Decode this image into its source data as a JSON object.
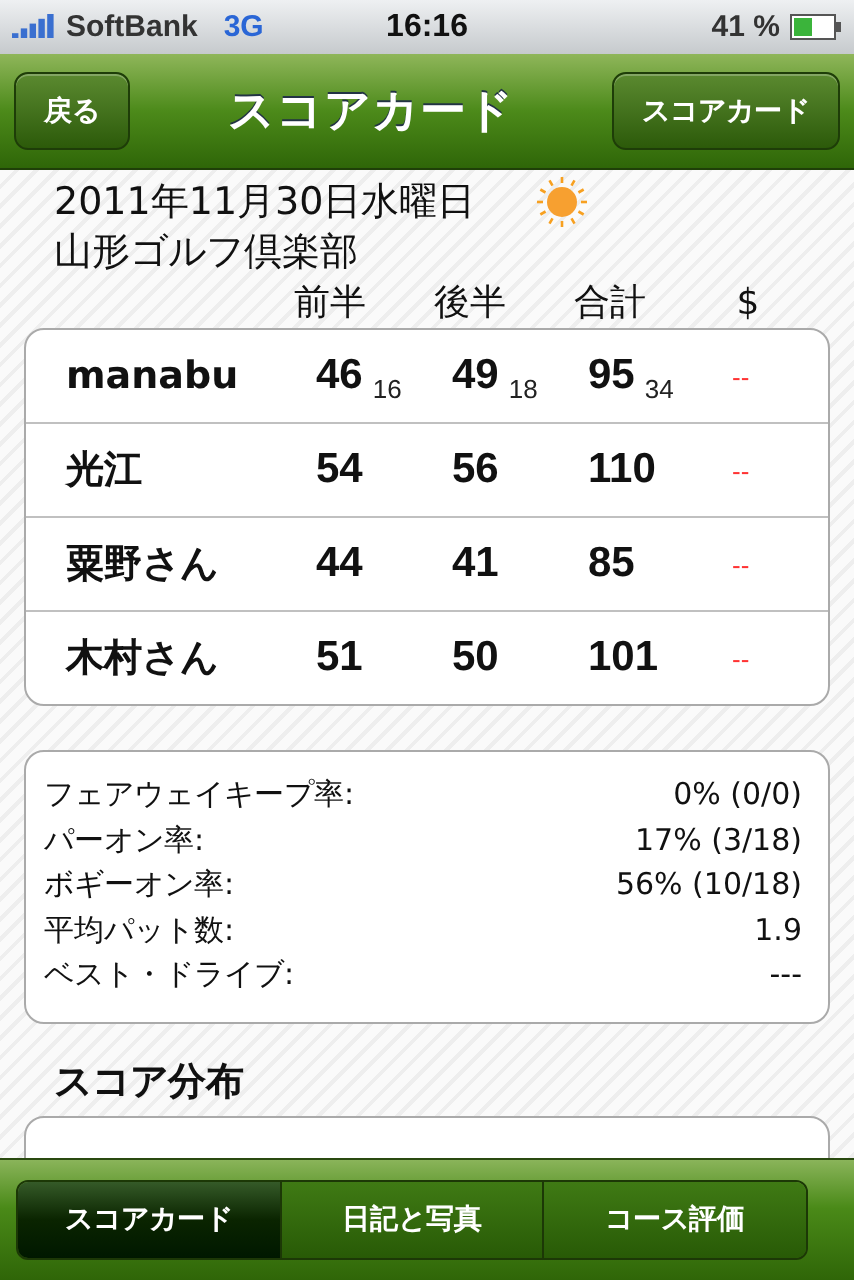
{
  "status_bar": {
    "carrier": "SoftBank",
    "network": "3G",
    "time": "16:16",
    "battery": "41 %"
  },
  "nav_bar": {
    "back_button": "戻る",
    "title": "スコアカード",
    "right_button": "スコアカード"
  },
  "round": {
    "date": "2011年11月30日水曜日",
    "course": "山形ゴルフ倶楽部"
  },
  "score_table": {
    "columns": [
      "前半",
      "後半",
      "合計",
      "$"
    ],
    "rows": [
      {
        "name": "manabu",
        "front": "46",
        "front_putts": "16",
        "back": "49",
        "back_putts": "18",
        "total": "95",
        "total_putts": "34",
        "money": "--"
      },
      {
        "name": "光江",
        "front": "54",
        "back": "56",
        "total": "110",
        "money": "--"
      },
      {
        "name": "粟野さん",
        "front": "44",
        "back": "41",
        "total": "85",
        "money": "--"
      },
      {
        "name": "木村さん",
        "front": "51",
        "back": "50",
        "total": "101",
        "money": "--"
      }
    ]
  },
  "stats": [
    {
      "label": "フェアウェイキープ率:",
      "value": "0% (0/0)"
    },
    {
      "label": "パーオン率:",
      "value": "17% (3/18)"
    },
    {
      "label": "ボギーオン率:",
      "value": "56% (10/18)"
    },
    {
      "label": "平均パット数:",
      "value": "1.9"
    },
    {
      "label": "ベスト・ドライブ:",
      "value": "---"
    }
  ],
  "score_distribution": {
    "heading": "スコア分布"
  },
  "tab_bar": [
    {
      "label": "スコアカード",
      "selected": true
    },
    {
      "label": "日記と写真",
      "selected": false
    },
    {
      "label": "コース評価",
      "selected": false
    }
  ]
}
